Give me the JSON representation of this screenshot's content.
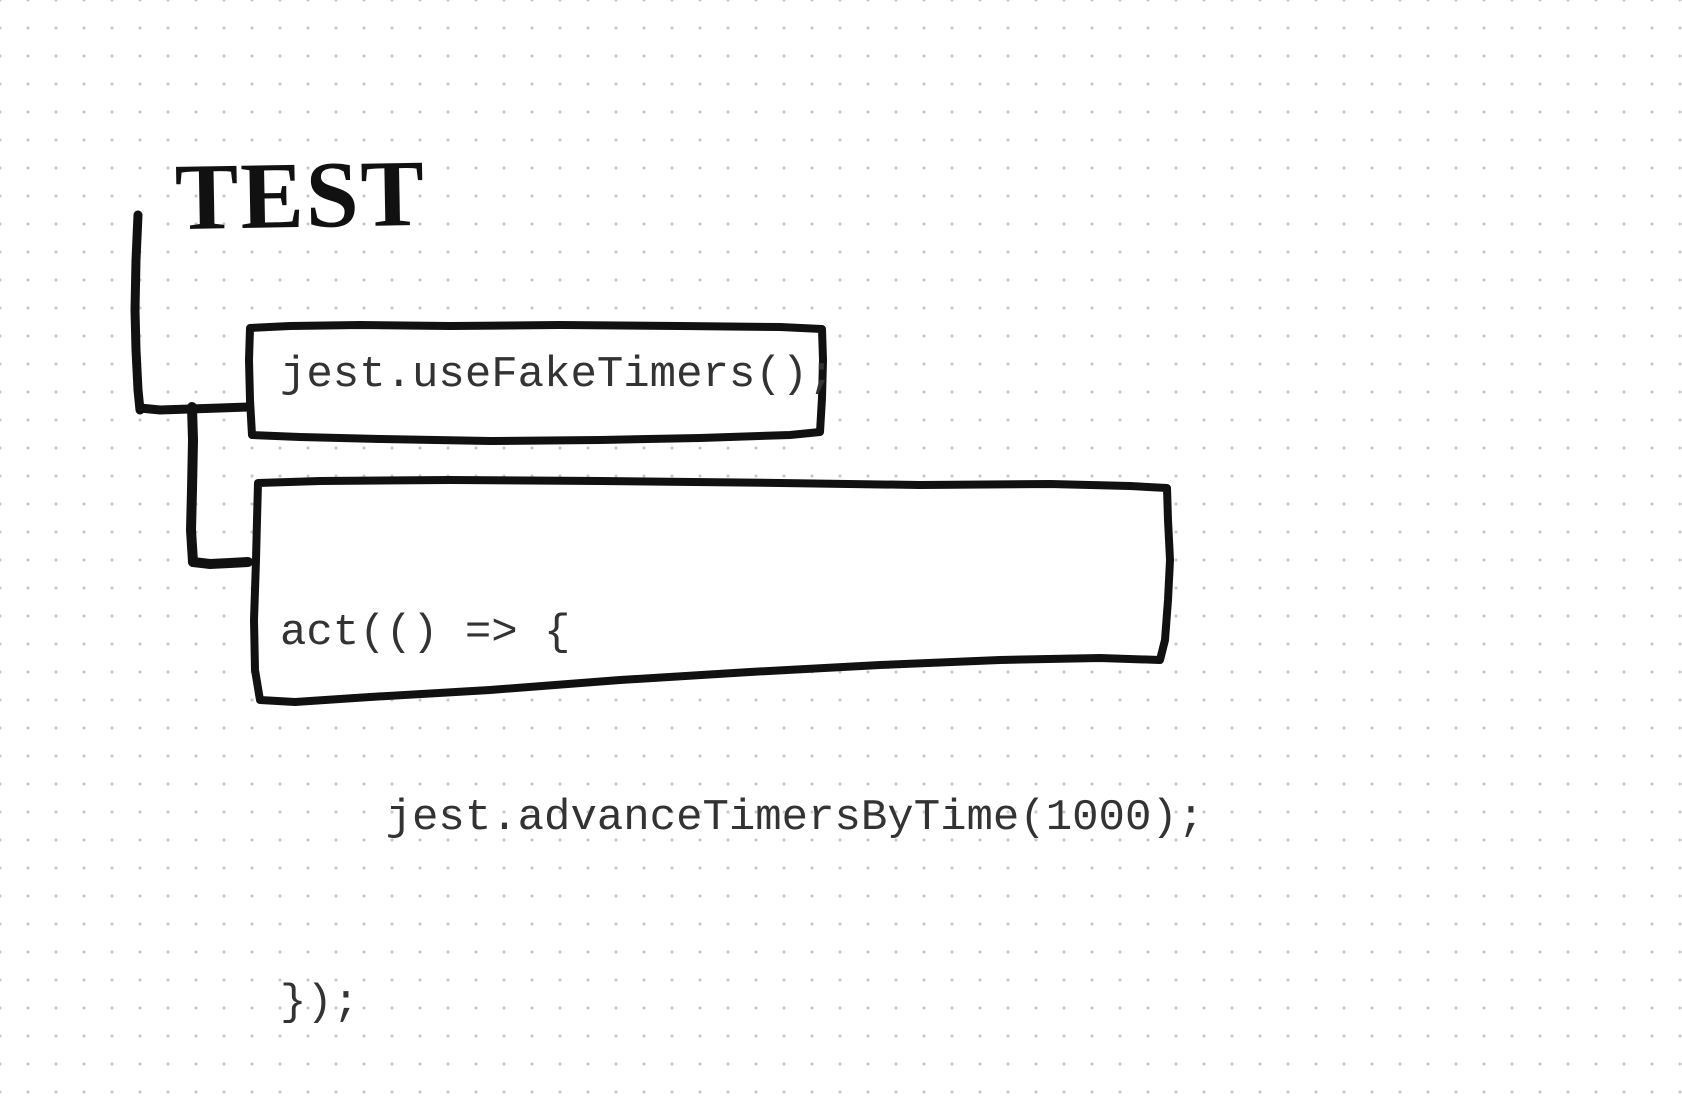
{
  "diagram": {
    "title": "TEST",
    "box1": {
      "code": "jest.useFakeTimers();"
    },
    "box2": {
      "line1": "act(() => {",
      "line2": "    jest.advanceTimersByTime(1000);",
      "line3": "});"
    }
  }
}
